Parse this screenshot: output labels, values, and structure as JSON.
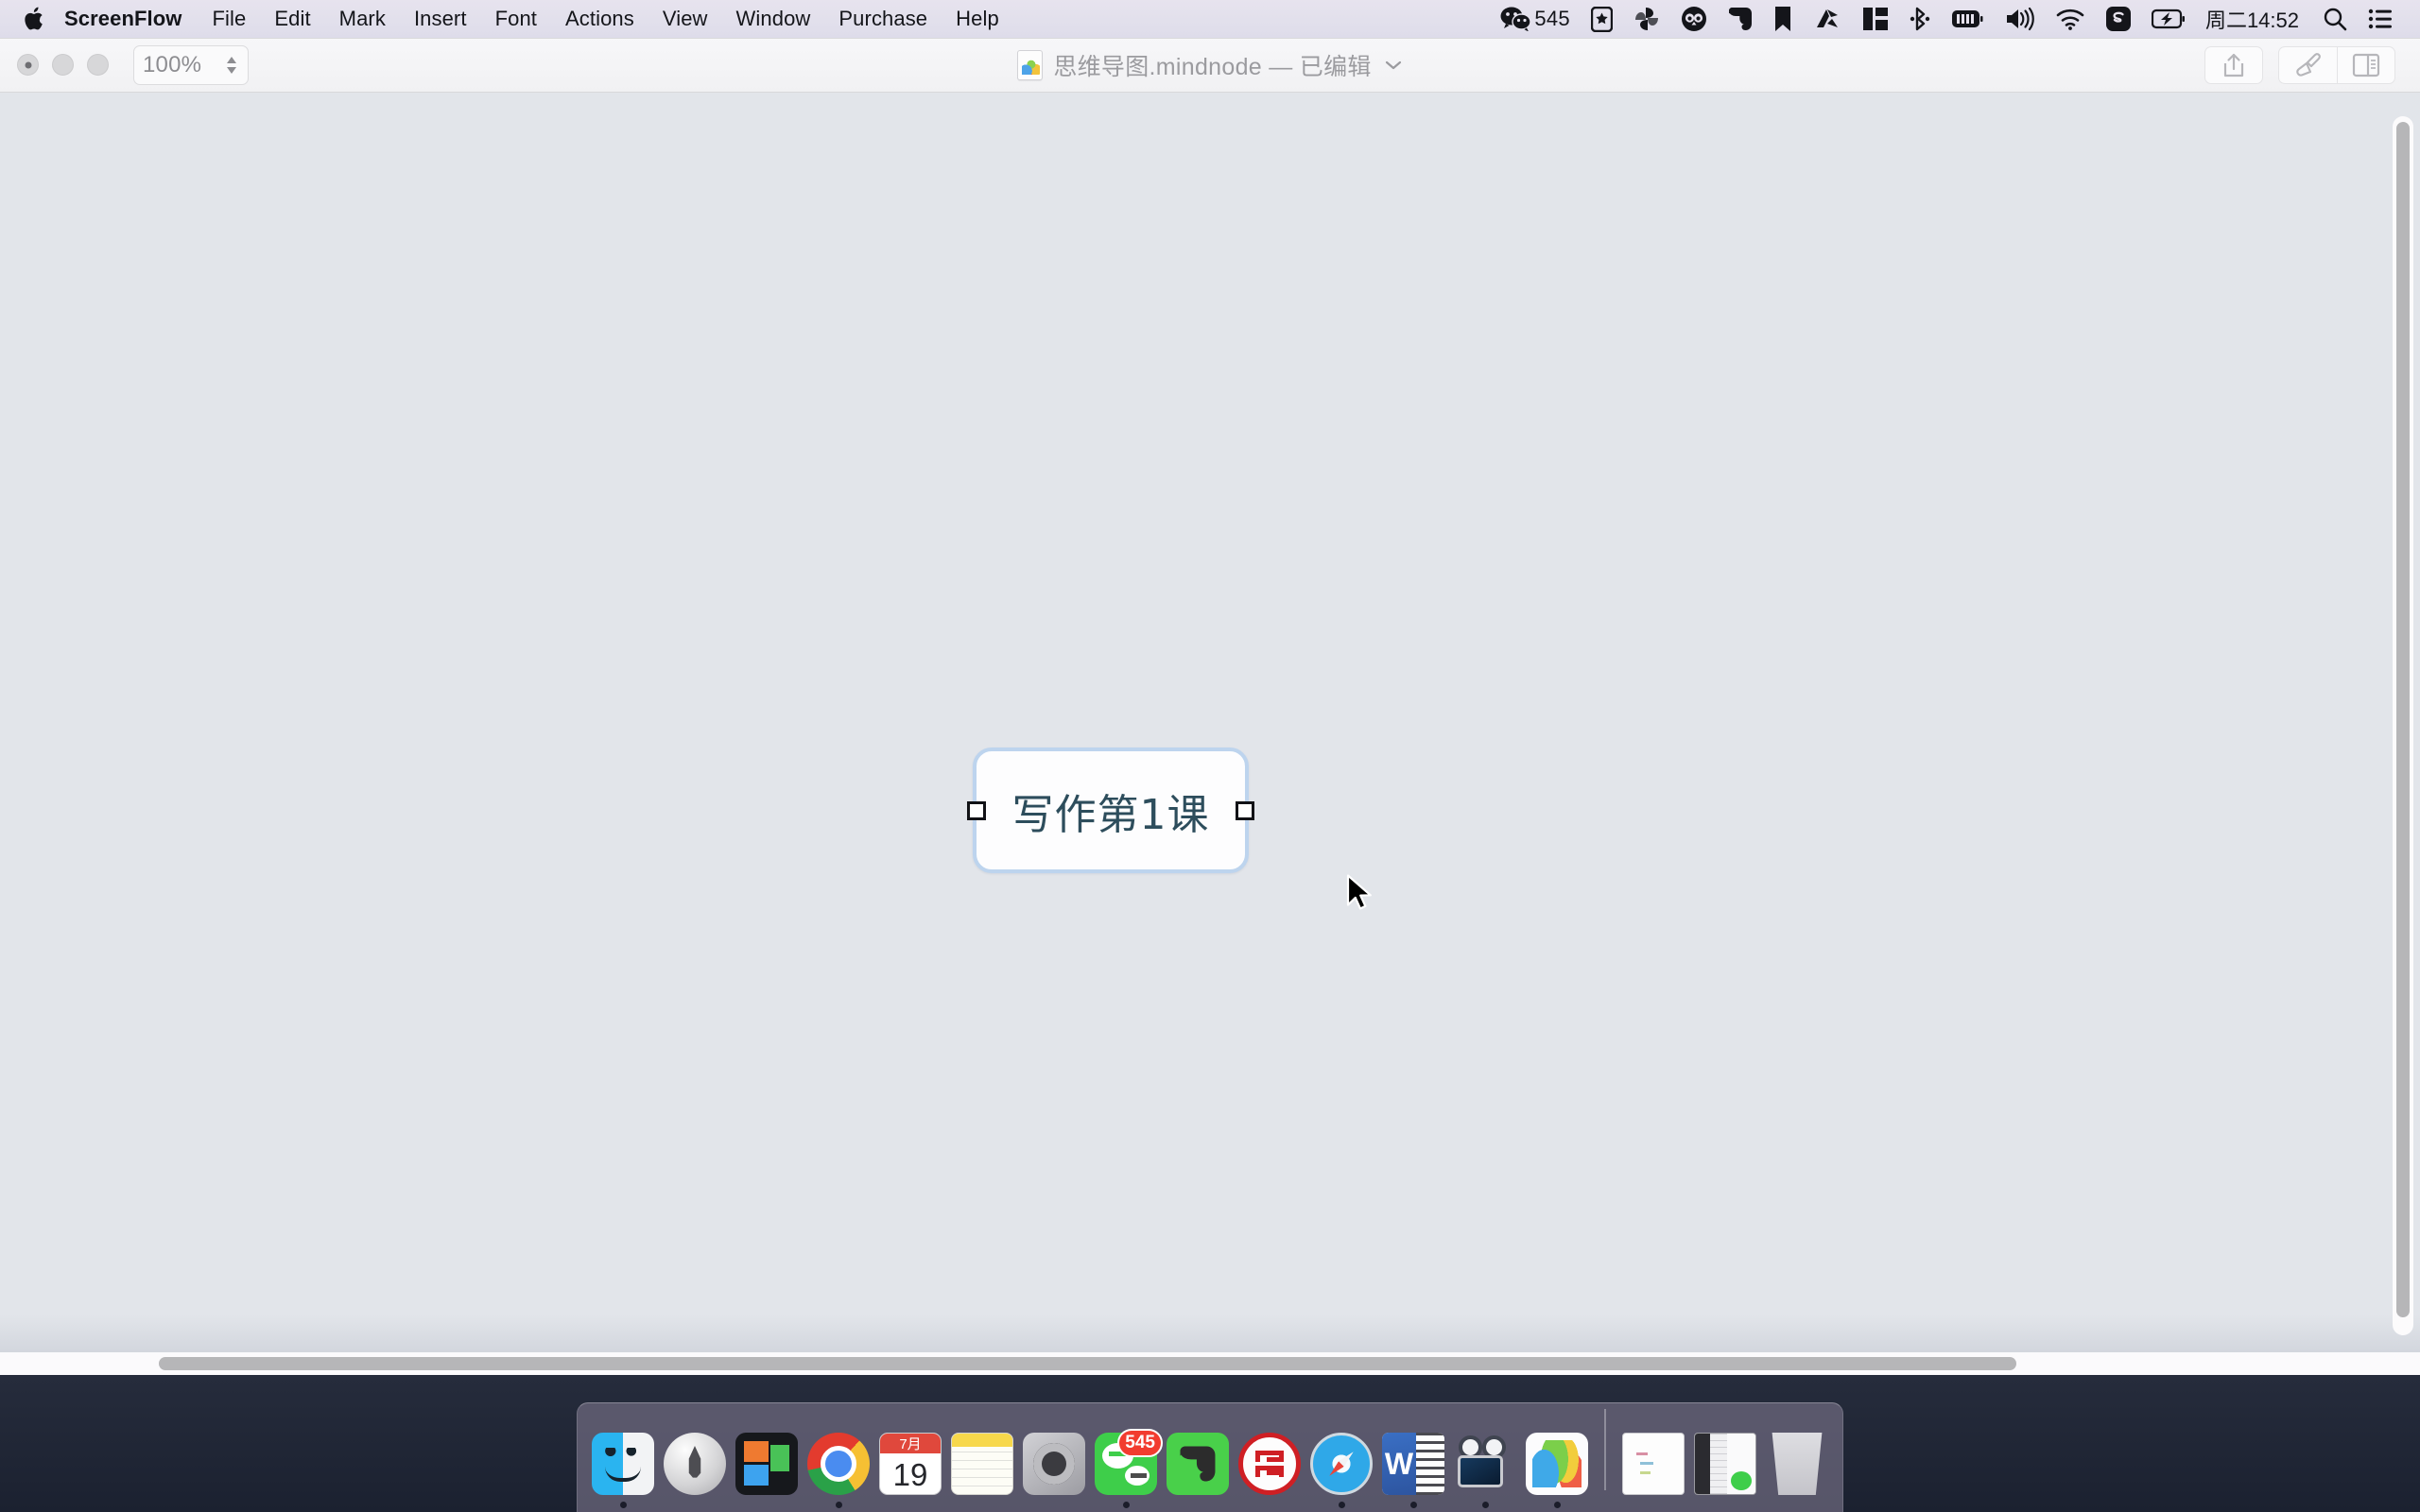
{
  "menubar": {
    "apple_icon": "apple-logo-icon",
    "app_name": "ScreenFlow",
    "items": [
      "File",
      "Edit",
      "Mark",
      "Insert",
      "Font",
      "Actions",
      "View",
      "Window",
      "Purchase",
      "Help"
    ],
    "status": {
      "wechat_icon": "wechat-icon",
      "wechat_count": "545",
      "pocket_icon": "pocket-star-icon",
      "pinwheel_icon": "pinwheel-icon",
      "owl_icon": "owl-icon",
      "evernote_icon": "evernote-elephant-icon",
      "bookmark_icon": "bookmark-flag-icon",
      "alfred_icon": "alfred-a-icon",
      "layout_icon": "window-layout-icon",
      "bluetooth_icon": "bluetooth-icon",
      "meter_icon": "cpu-meter-icon",
      "volume_icon": "volume-icon",
      "wifi_icon": "wifi-icon",
      "screenflow_icon": "screenflow-s-icon",
      "battery_icon": "battery-charging-icon",
      "clock": "周二14:52",
      "search_icon": "search-icon",
      "notification_icon": "notification-center-icon"
    }
  },
  "window": {
    "traffic": {
      "close": "close-button",
      "minimize": "minimize-button",
      "maximize": "maximize-button"
    },
    "zoom": {
      "value": "100%",
      "stepper_icon": "stepper-chevrons-icon"
    },
    "title": {
      "doc_icon": "mindnode-document-icon",
      "text": "思维导图.mindnode — 已编辑",
      "chevron_icon": "chevron-down-icon"
    },
    "toolbar_right": {
      "share_icon": "share-icon",
      "style_icon": "paintbrush-icon",
      "inspector_icon": "inspector-panel-icon"
    }
  },
  "canvas": {
    "node": {
      "label": "写作第1课",
      "handle_left": "resize-handle-left",
      "handle_right": "resize-handle-right"
    },
    "vertical_scrollbar": "vertical-scrollbar",
    "horizontal_scrollbar": "horizontal-scrollbar"
  },
  "cursor": {
    "icon": "mouse-pointer-icon"
  },
  "dock": {
    "items": [
      {
        "name": "finder",
        "label": "Finder",
        "running": true
      },
      {
        "name": "launchpad",
        "label": "Launchpad",
        "running": false
      },
      {
        "name": "mission-control",
        "label": "Mission Control",
        "running": false
      },
      {
        "name": "chrome",
        "label": "Google Chrome",
        "running": true
      },
      {
        "name": "calendar",
        "label": "Calendar",
        "month": "7月",
        "day": "19",
        "running": false
      },
      {
        "name": "notes",
        "label": "Notes",
        "running": false
      },
      {
        "name": "system-preferences",
        "label": "System Preferences",
        "running": false
      },
      {
        "name": "wechat",
        "label": "WeChat",
        "badge": "545",
        "running": true
      },
      {
        "name": "evernote",
        "label": "Evernote",
        "running": false
      },
      {
        "name": "icbc",
        "label": "ICBC",
        "running": false
      },
      {
        "name": "safari",
        "label": "Safari",
        "running": true
      },
      {
        "name": "word",
        "label": "Microsoft Word",
        "letter": "W",
        "running": true
      },
      {
        "name": "screenflow",
        "label": "ScreenFlow",
        "running": true
      },
      {
        "name": "mindnode",
        "label": "MindNode",
        "running": true
      }
    ],
    "minimized": [
      {
        "name": "minimized-mindnode",
        "label": "思维导图.mindnode"
      },
      {
        "name": "minimized-wechat",
        "label": "WeChat"
      }
    ],
    "trash": {
      "name": "trash",
      "label": "Trash"
    }
  }
}
